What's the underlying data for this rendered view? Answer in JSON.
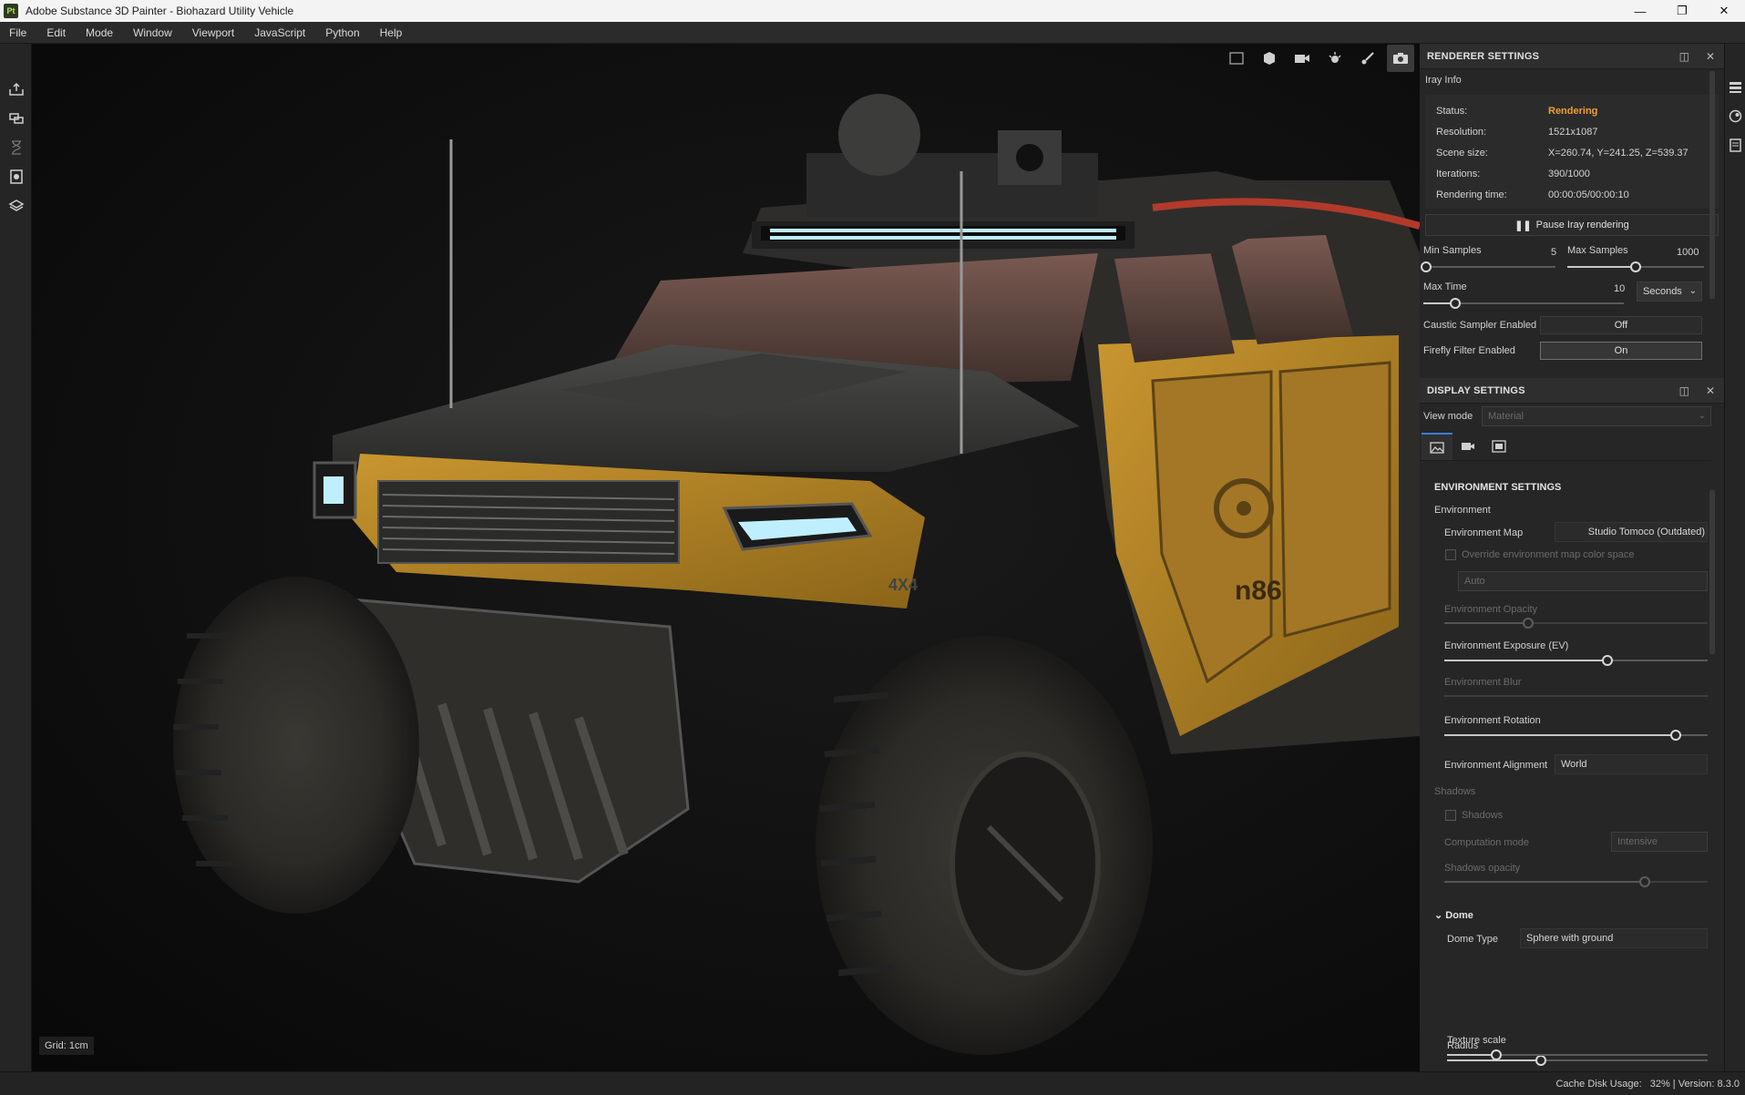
{
  "window": {
    "app_badge": "Pt",
    "title": "Adobe Substance 3D Painter - Biohazard Utility Vehicle",
    "controls": [
      "minimize-icon",
      "restore-icon",
      "close-icon"
    ]
  },
  "menu": {
    "items": [
      {
        "label": "File"
      },
      {
        "label": "Edit"
      },
      {
        "label": "Mode"
      },
      {
        "label": "Window"
      },
      {
        "label": "Viewport"
      },
      {
        "label": "JavaScript"
      },
      {
        "label": "Python"
      },
      {
        "label": "Help"
      }
    ]
  },
  "left_toolbar": {
    "icons": [
      "export-icon",
      "bake-icon",
      "hourglass-icon",
      "texture-set-icon",
      "mesh-icon"
    ]
  },
  "viewport": {
    "tools": [
      "2d-view-icon",
      "3d-view-icon",
      "camera-icon",
      "lighting-icon",
      "brush-icon",
      "screenshot-icon"
    ],
    "active_tool": "screenshot-icon",
    "grid_label": "Grid: 1cm",
    "vehicle_decals": {
      "front_badge": "4X4",
      "door_number": "n86"
    }
  },
  "renderer": {
    "title": "RENDERER SETTINGS",
    "subhead": "Iray Info",
    "info": [
      {
        "key": "Status:",
        "value": "Rendering"
      },
      {
        "key": "Resolution:",
        "value": "1521x1087"
      },
      {
        "key": "Scene size:",
        "value": "X=260.74, Y=241.25, Z=539.37"
      },
      {
        "key": "Iterations:",
        "value": "390/1000"
      },
      {
        "key": "Rendering time:",
        "value": "00:00:05/00:00:10"
      }
    ],
    "pause_button": "Pause Iray rendering",
    "min_samples_label": "Min Samples",
    "min_samples_value": "5",
    "min_samples_fraction": 0.02,
    "max_samples_label": "Max Samples",
    "max_samples_value": "1000",
    "max_samples_fraction": 0.5,
    "max_time_label": "Max Time",
    "max_time_value": "10",
    "max_time_fraction": 0.16,
    "time_unit": "Seconds",
    "caustic_label": "Caustic Sampler Enabled",
    "caustic_value": "Off",
    "firefly_label": "Firefly Filter Enabled",
    "firefly_value": "On"
  },
  "display": {
    "title": "DISPLAY SETTINGS",
    "view_mode_label": "View mode",
    "view_mode_value": "Material",
    "tabs": [
      "environment-tab-icon",
      "camera-tab-icon",
      "viewer-tab-icon"
    ],
    "env_section_title": "ENVIRONMENT SETTINGS",
    "env_group": "Environment",
    "env_map_label": "Environment Map",
    "env_map_value": "Studio Tomoco (Outdated)",
    "override_label": "Override environment map color space",
    "override_checked": false,
    "color_space_value": "Auto",
    "env_opacity_label": "Environment Opacity",
    "env_opacity_fraction": 0.32,
    "env_exposure_label": "Environment Exposure (EV)",
    "env_exposure_fraction": 0.62,
    "env_blur_label": "Environment Blur",
    "env_rotation_label": "Environment Rotation",
    "env_rotation_fraction": 0.88,
    "env_alignment_label": "Environment Alignment",
    "env_alignment_value": "World",
    "shadows_group": "Shadows",
    "shadows_label": "Shadows",
    "shadows_checked": false,
    "computation_label": "Computation mode",
    "computation_value": "Intensive",
    "shadows_opacity_label": "Shadows opacity",
    "shadows_opacity_fraction": 0.76,
    "dome_title": "Dome",
    "dome_type_label": "Dome Type",
    "dome_type_value": "Sphere with ground",
    "radius_label": "Radius",
    "radius_fraction": 0.36,
    "texture_scale_label": "Texture scale",
    "texture_scale_fraction": 0.19
  },
  "right_dock": {
    "icons": [
      "layers-icon",
      "shelf-icon",
      "history-icon"
    ]
  },
  "status": {
    "cache_label": "Cache Disk Usage:",
    "cache_value": "32%",
    "version": "Version: 8.3.0"
  },
  "colors": {
    "accent_status": "#f0a030",
    "tab_active": "#3b7dd8",
    "vehicle_yellow": "#b8862a",
    "led_cyan": "#bfefff"
  }
}
